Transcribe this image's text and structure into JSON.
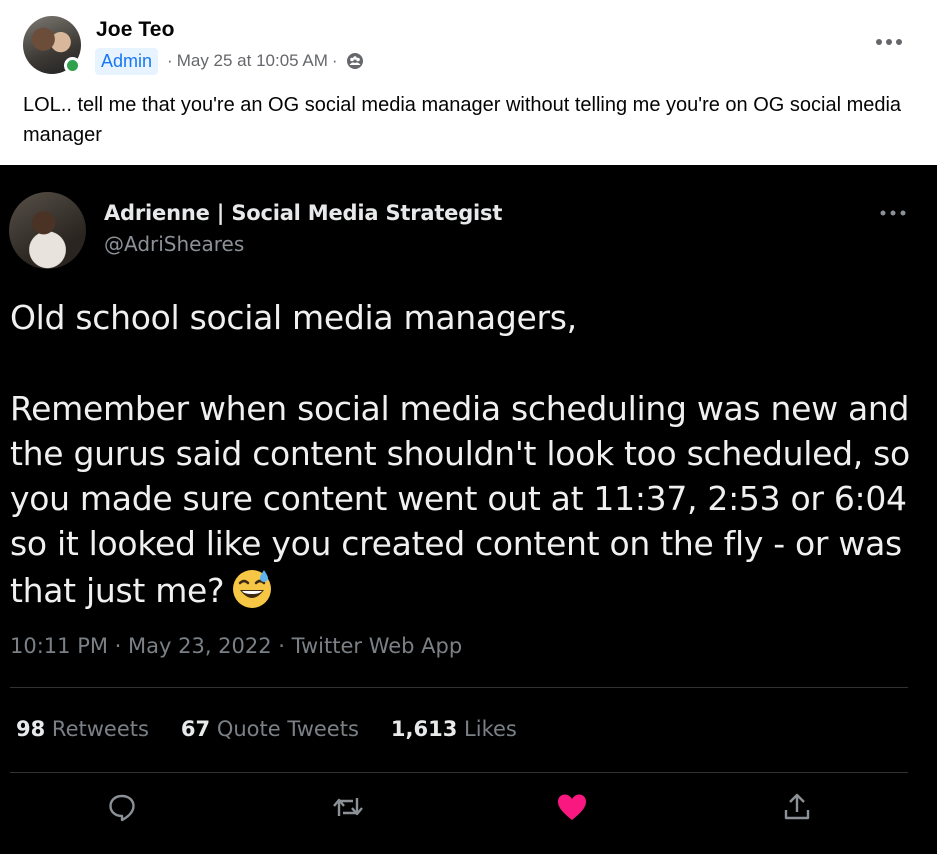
{
  "post": {
    "author": "Joe Teo",
    "badge": "Admin",
    "separator": "·",
    "timestamp": "May 25 at 10:05 AM",
    "privacy_icon": "group-icon",
    "more_icon": "more-horizontal-icon",
    "text": "LOL.. tell me that you're an OG social media manager without telling me you're on OG social media manager"
  },
  "tweet": {
    "name": "Adrienne | Social Media Strategist",
    "handle": "@AdriSheares",
    "line1": "Old school social media managers,",
    "body": "Remember when social media scheduling was new and the gurus said content shouldn't look too scheduled, so you made sure content went out at 11:37, 2:53 or 6:04 so it looked like you created content on the fly - or was that just me?",
    "emoji": "grinning-face-with-sweat-emoji",
    "meta": "10:11 PM · May 23, 2022 · Twitter Web App",
    "stats": {
      "retweets_count": "98",
      "retweets_label": "Retweets",
      "quotes_count": "67",
      "quotes_label": "Quote Tweets",
      "likes_count": "1,613",
      "likes_label": "Likes"
    },
    "actions": [
      "reply-icon",
      "retweet-icon",
      "like-icon",
      "share-icon"
    ],
    "like_color": "#f91880"
  },
  "colors": {
    "online": "#31a24c",
    "admin_badge_bg": "#e7f3ff",
    "admin_badge_text": "#1877f2",
    "tweet_bg": "#000000"
  }
}
